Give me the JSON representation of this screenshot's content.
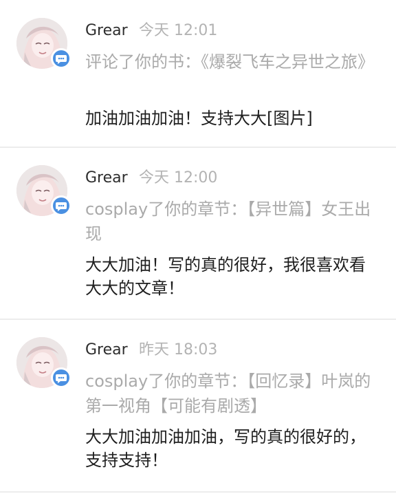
{
  "notifications": [
    {
      "username": "Grear",
      "time": "今天 12:01",
      "action": "评论了你的书：《爆裂飞车之异世之旅》",
      "content": "加油加油加油！支持大大[图片]",
      "avatar_icon": "anime-girl-avatar",
      "badge_icon": "comment-bubble-icon"
    },
    {
      "username": "Grear",
      "time": "今天 12:00",
      "action": "cosplay了你的章节：【异世篇】女王出现",
      "content": "大大加油！写的真的很好，我很喜欢看大大的文章！",
      "avatar_icon": "anime-girl-avatar",
      "badge_icon": "comment-bubble-icon"
    },
    {
      "username": "Grear",
      "time": "昨天 18:03",
      "action": "cosplay了你的章节：【回忆录】叶岚的第一视角【可能有剧透】",
      "content": "大大加油加油加油，写的真的很好的，支持支持！",
      "avatar_icon": "anime-girl-avatar",
      "badge_icon": "comment-bubble-icon"
    }
  ],
  "colors": {
    "badge": "#4a90e2",
    "username": "#2d2d2d",
    "meta": "#b3b3b3",
    "content": "#1e1e1e",
    "divider": "#ececec"
  }
}
